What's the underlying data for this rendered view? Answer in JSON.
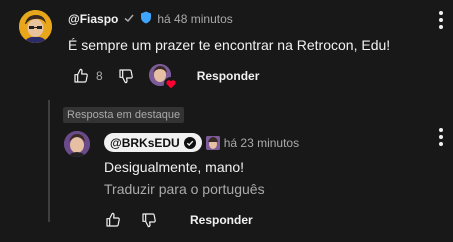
{
  "comment": {
    "handle": "@Fiaspo",
    "time": "há 48 minutos",
    "text": "É sempre um prazer te encontrar na Retrocon, Edu!",
    "likes": "8",
    "reply_label": "Responder"
  },
  "highlight_label": "Resposta em destaque",
  "reply": {
    "handle": "@BRKsEDU",
    "time": "há 23 minutos",
    "text": "Desigualmente, mano!",
    "translate_label": "Traduzir para o português",
    "reply_label": "Responder"
  },
  "colors": {
    "background": "#181818",
    "text": "#f1f1f1",
    "secondary_text": "#aaaaaa",
    "verified_badge": "#3ea6ff",
    "heart": "#ff0033"
  },
  "icons": [
    "check-icon",
    "verified-badge-icon",
    "thumb-up-icon",
    "thumb-down-icon",
    "heart-icon",
    "more-vert-icon",
    "check-circle-icon"
  ]
}
